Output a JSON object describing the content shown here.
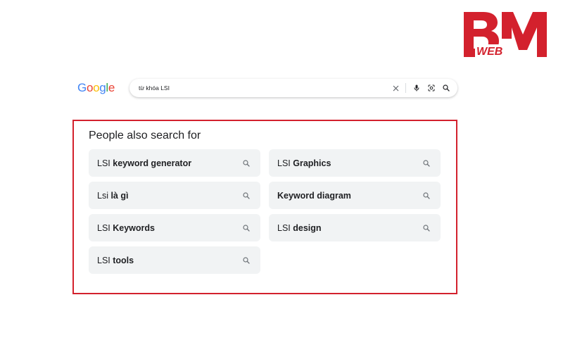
{
  "brand": {
    "logo_letters": "BM",
    "logo_sub": "WEB",
    "color": "#d3212d"
  },
  "google": {
    "letters": [
      "G",
      "o",
      "o",
      "g",
      "l",
      "e"
    ],
    "colors": [
      "#4285F4",
      "#EA4335",
      "#FBBC05",
      "#4285F4",
      "#34A853",
      "#EA4335"
    ]
  },
  "search": {
    "value": "từ khóa LSI",
    "icons": [
      "close-icon",
      "microphone-icon",
      "google-lens-icon",
      "search-icon"
    ]
  },
  "people_also_search": {
    "title": "People also search for",
    "highlight_color": "#d3212d",
    "items": [
      {
        "prefix": "LSI ",
        "bold": "keyword generator"
      },
      {
        "prefix": "LSI ",
        "bold": "Graphics"
      },
      {
        "prefix": "Lsi ",
        "bold": "là gì"
      },
      {
        "prefix": "",
        "bold": "Keyword diagram"
      },
      {
        "prefix": "LSI ",
        "bold": "Keywords"
      },
      {
        "prefix": "LSI ",
        "bold": "design"
      },
      {
        "prefix": "LSI ",
        "bold": "tools"
      }
    ]
  }
}
